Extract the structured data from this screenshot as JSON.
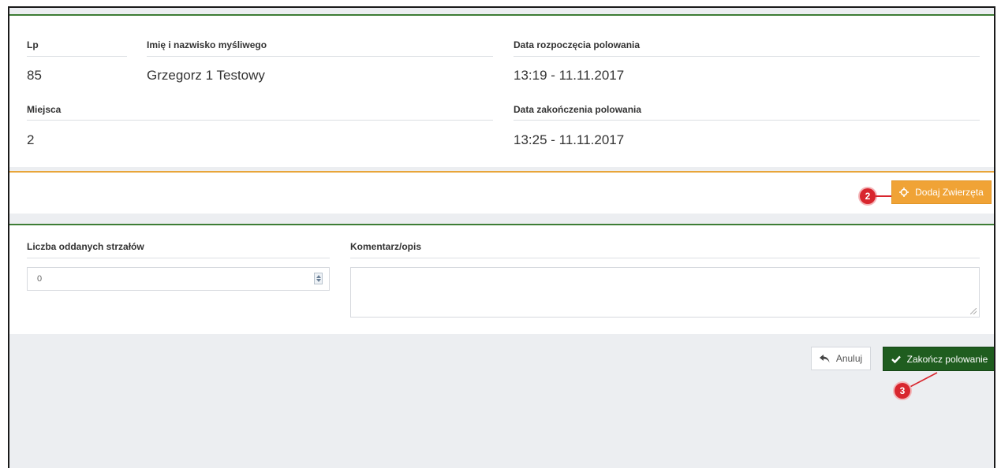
{
  "details": {
    "lp_label": "Lp",
    "lp_value": "85",
    "hunter_label": "Imię i nazwisko myśliwego",
    "hunter_value": "Grzegorz 1 Testowy",
    "start_label": "Data rozpoczęcia polowania",
    "start_value": "13:19 - 11.11.2017",
    "places_label": "Miejsca",
    "places_value": "2",
    "end_label": "Data zakończenia polowania",
    "end_value": "13:25 - 11.11.2017"
  },
  "animals": {
    "add_button_label": "Dodaj Zwierzęta",
    "add_button_icon": "crosshair-icon"
  },
  "form": {
    "shots_label": "Liczba oddanych strzałów",
    "shots_value": "0",
    "comment_label": "Komentarz/opis",
    "comment_value": ""
  },
  "actions": {
    "cancel_label": "Anuluj",
    "cancel_icon": "reply-arrow-icon",
    "finish_label": "Zakończ polowanie",
    "finish_icon": "checkmark-icon"
  },
  "annotations": {
    "marker_add": "2",
    "marker_finish": "3"
  },
  "colors": {
    "accent_green": "#1f5d1f",
    "accent_orange": "#f0a336",
    "marker_red": "#d8262e"
  }
}
